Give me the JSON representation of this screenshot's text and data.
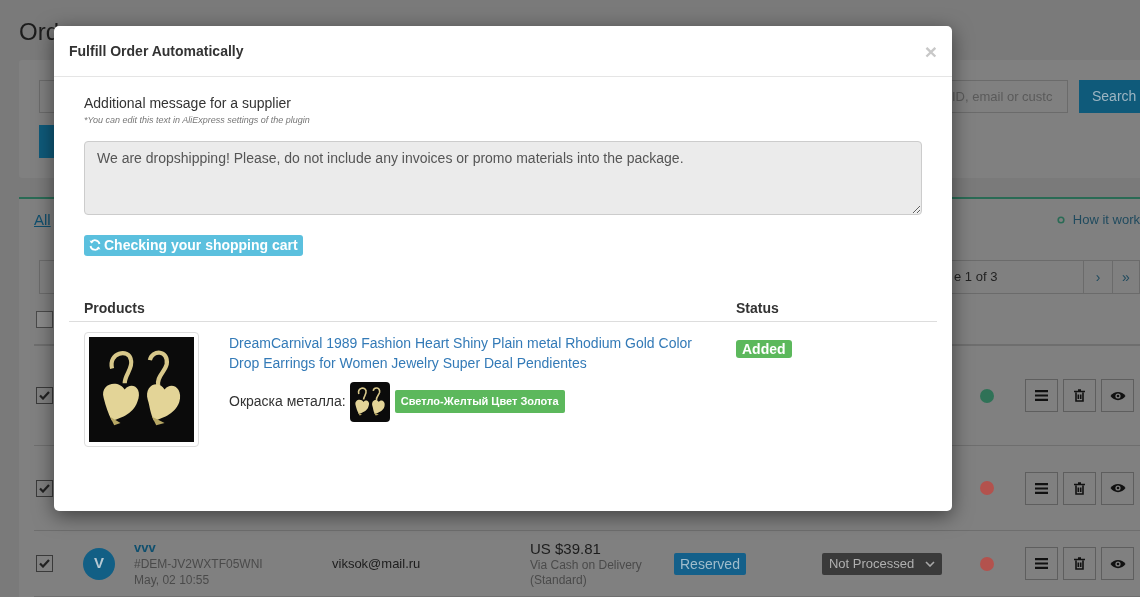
{
  "page": {
    "title": "Ord",
    "search": {
      "placeholder": "ID, email or custc"
    },
    "search_button": "Search",
    "filter_link": "All",
    "help_link": "How it work",
    "pagination": {
      "page_label": "e 1 of 3",
      "next": "›",
      "last": "»"
    },
    "select_all": {
      "checked": false
    },
    "orders": [
      {
        "checked": true,
        "color": "#2f7257"
      },
      {
        "checked": true,
        "color": "#b3524d"
      },
      {
        "checked": true,
        "color": "#b3524d",
        "avatar": "V",
        "customer": "vvv",
        "order_id": "#DEM-JV2WXTF05WNI",
        "date": "May, 02 10:55",
        "email": "viksok@mail.ru",
        "total": "US $39.81",
        "payment": "Via Cash on Delivery",
        "shipping": "(Standard)",
        "reservation": "Reserved",
        "fulfillment": "Not Processed"
      }
    ]
  },
  "modal": {
    "title": "Fulfill Order Automatically",
    "close": "×",
    "message_label": "Additional message for a supplier",
    "message_hint": "*You can edit this text in AliExpress settings of the plugin",
    "message": "We are dropshipping! Please, do not include any invoices or promo materials into the package.",
    "check_button": "Checking your shopping cart",
    "columns": [
      "Products",
      "Status"
    ],
    "products": [
      {
        "kind": "picture",
        "title": "DreamCarnival 1989 Fashion Heart Shiny Plain metal Rhodium Gold Color Drop Earrings for Women Jewelry Super Deal Pendientes",
        "option_name": "Окраска металла:",
        "option_value": "Светло-Желтый Цвет Золота",
        "status": "Added"
      }
    ]
  }
}
